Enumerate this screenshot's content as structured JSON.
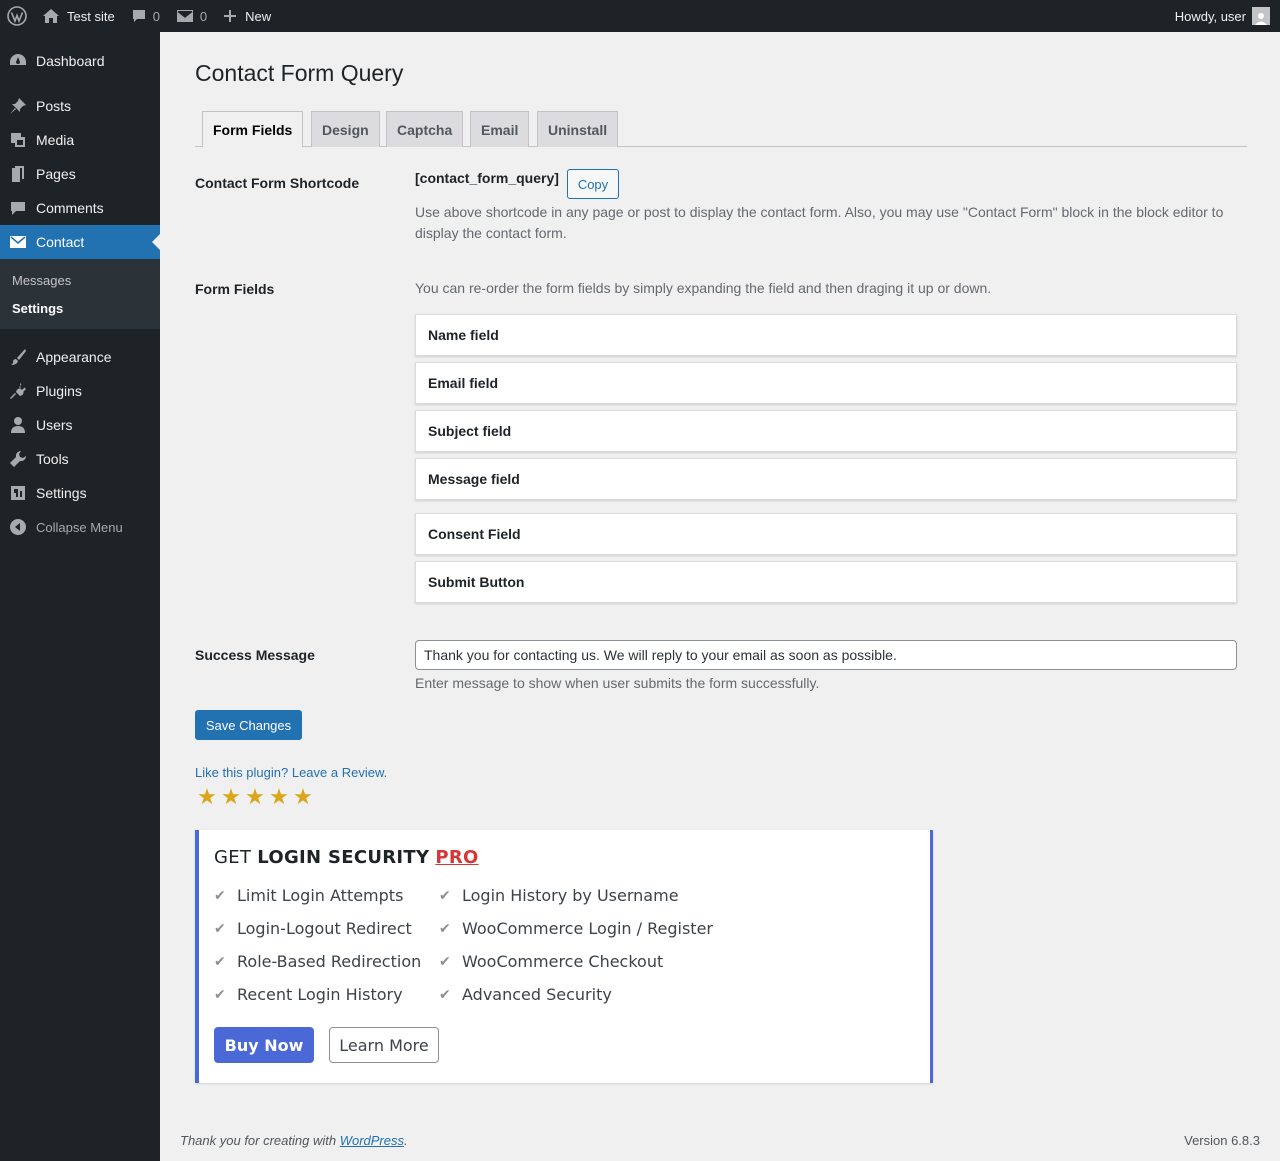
{
  "adminbar": {
    "site_name": "Test site",
    "comments_count": "0",
    "messages_count": "0",
    "new_label": "New",
    "howdy": "Howdy, user"
  },
  "sidebar": {
    "items": [
      {
        "label": "Dashboard",
        "icon": "dashboard-icon"
      },
      {
        "label": "Posts",
        "icon": "pin-icon"
      },
      {
        "label": "Media",
        "icon": "media-icon"
      },
      {
        "label": "Pages",
        "icon": "pages-icon"
      },
      {
        "label": "Comments",
        "icon": "comment-icon"
      },
      {
        "label": "Contact",
        "icon": "envelope-icon"
      },
      {
        "label": "Appearance",
        "icon": "brush-icon"
      },
      {
        "label": "Plugins",
        "icon": "plug-icon"
      },
      {
        "label": "Users",
        "icon": "user-icon"
      },
      {
        "label": "Tools",
        "icon": "wrench-icon"
      },
      {
        "label": "Settings",
        "icon": "settings-icon"
      }
    ],
    "submenu": [
      "Messages",
      "Settings"
    ],
    "collapse_label": "Collapse Menu"
  },
  "page": {
    "title": "Contact Form Query",
    "tabs": [
      "Form Fields",
      "Design",
      "Captcha",
      "Email",
      "Uninstall"
    ],
    "active_tab": "Form Fields"
  },
  "shortcode_row": {
    "label": "Contact Form Shortcode",
    "shortcode": "[contact_form_query]",
    "copy_label": "Copy",
    "description_line1": "Use above shortcode in any page or post to display the contact form. Also, you may use \"Contact Form\" block in the block editor to",
    "description_line2": "display the contact form."
  },
  "form_fields_row": {
    "label": "Form Fields",
    "description": "You can re-order the form fields by simply expanding the field and then draging it up or down.",
    "fields": [
      "Name field",
      "Email field",
      "Subject field",
      "Message field",
      "Consent Field",
      "Submit Button"
    ]
  },
  "success_row": {
    "label": "Success Message",
    "value": "Thank you for contacting us. We will reply to your email as soon as possible.",
    "description": "Enter message to show when user submits the form successfully."
  },
  "save_label": "Save Changes",
  "review": {
    "link_text": "Like this plugin? Leave a Review.",
    "stars": 5,
    "star_color": "#dba617"
  },
  "promo": {
    "title_prefix": "GET",
    "title_main": "LOGIN SECURITY",
    "title_pro": "PRO",
    "features_left": [
      "Limit Login Attempts",
      "Login-Logout Redirect",
      "Role-Based Redirection",
      "Recent Login History"
    ],
    "features_right": [
      "Login History by Username",
      "WooCommerce Login / Register",
      "WooCommerce Checkout",
      "Advanced Security"
    ],
    "buy_label": "Buy Now",
    "learn_label": "Learn More",
    "accent_color": "#4a68d6"
  },
  "footer": {
    "thanks_prefix": "Thank you for creating with",
    "wp_link": "WordPress",
    "thanks_suffix": ".",
    "version": "Version 6.8.3"
  },
  "colors": {
    "admin_bg": "#1d2327",
    "primary": "#2271b1",
    "content_bg": "#f0f0f1"
  }
}
